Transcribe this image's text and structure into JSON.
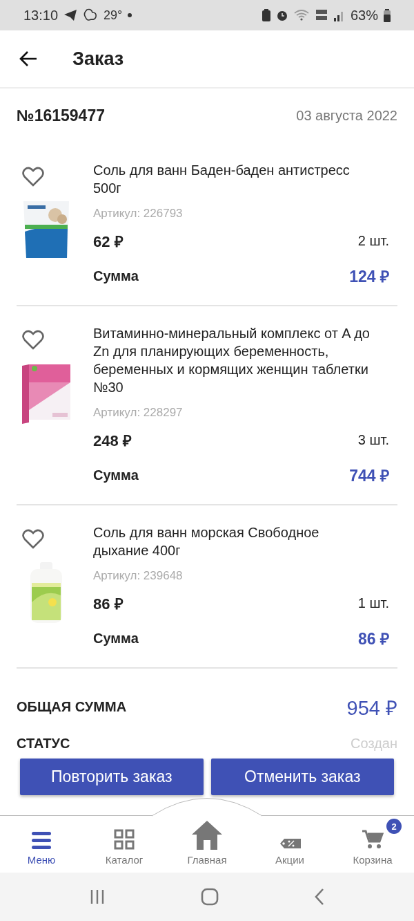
{
  "status_bar": {
    "time": "13:10",
    "temperature": "29°",
    "battery": "63%"
  },
  "header": {
    "title": "Заказ"
  },
  "order": {
    "number": "№16159477",
    "date": "03 августа 2022"
  },
  "items": [
    {
      "name": "Соль для ванн Баден-баден антистресс 500г",
      "article": "Артикул: 226793",
      "price": "62 ₽",
      "qty": "2 шт.",
      "sum_label": "Сумма",
      "sum": "124 ₽",
      "favorite": false
    },
    {
      "name": "Витаминно-минеральный комплекс от A до Zn для планирующих беременность, беременных и кормящих женщин таблетки №30",
      "article": "Артикул: 228297",
      "price": "248 ₽",
      "qty": "3 шт.",
      "sum_label": "Сумма",
      "sum": "744 ₽",
      "favorite": false
    },
    {
      "name": "Соль для ванн морская Свободное дыхание 400г",
      "article": "Артикул: 239648",
      "price": "86 ₽",
      "qty": "1 шт.",
      "sum_label": "Сумма",
      "sum": "86 ₽",
      "favorite": false
    }
  ],
  "total": {
    "label": "ОБЩАЯ СУММА",
    "value": "954 ₽"
  },
  "status": {
    "label": "СТАТУС",
    "value": "Создан"
  },
  "buttons": [
    "Повторить заказ",
    "Отменить заказ"
  ],
  "bottom_nav": [
    {
      "label": "Меню",
      "selected": true
    },
    {
      "label": "Каталог",
      "selected": false
    },
    {
      "label": "Главная",
      "selected": false
    },
    {
      "label": "Акции",
      "selected": false
    },
    {
      "label": "Корзина",
      "selected": false,
      "badge": "2"
    }
  ]
}
